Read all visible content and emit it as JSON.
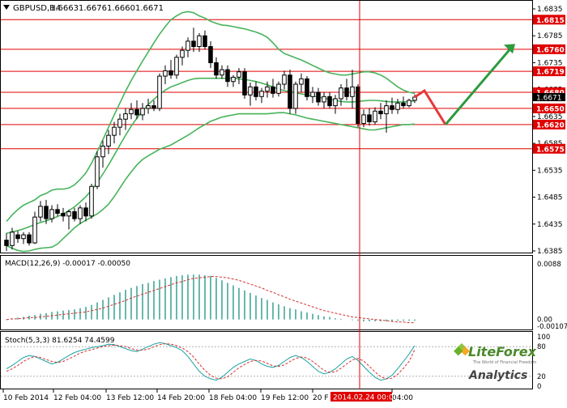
{
  "chart_data": {
    "type": "candlestick",
    "symbol_header": "GBPUSD,H4",
    "ohlc_header": [
      "1.6663",
      "1.6676",
      "1.6660",
      "1.6671"
    ],
    "x_tick_labels": [
      "10 Feb 2014",
      "12 Feb 04:00",
      "13 Feb 12:00",
      "14 Feb 20:00",
      "18 Feb 04:00",
      "19 Feb 12:00",
      "20 F",
      "04:00"
    ],
    "price_axis": {
      "ylim": [
        1.6385,
        1.6835
      ],
      "tick_labels": [
        "1.6835",
        "1.6785",
        "1.6735",
        "1.6685",
        "1.6635",
        "1.6585",
        "1.6535",
        "1.6485",
        "1.6435",
        "1.6385"
      ],
      "current_price": "1.6671"
    },
    "candles": [
      {
        "o": 1.6405,
        "h": 1.6418,
        "l": 1.6385,
        "c": 1.6395
      },
      {
        "o": 1.6395,
        "h": 1.6428,
        "l": 1.6388,
        "c": 1.642
      },
      {
        "o": 1.6415,
        "h": 1.6422,
        "l": 1.64,
        "c": 1.6408
      },
      {
        "o": 1.6408,
        "h": 1.642,
        "l": 1.6398,
        "c": 1.6415
      },
      {
        "o": 1.6415,
        "h": 1.642,
        "l": 1.6395,
        "c": 1.64
      },
      {
        "o": 1.64,
        "h": 1.6458,
        "l": 1.6398,
        "c": 1.6448
      },
      {
        "o": 1.6448,
        "h": 1.6478,
        "l": 1.644,
        "c": 1.6468
      },
      {
        "o": 1.6468,
        "h": 1.648,
        "l": 1.6435,
        "c": 1.6445
      },
      {
        "o": 1.6445,
        "h": 1.647,
        "l": 1.6438,
        "c": 1.6462
      },
      {
        "o": 1.6462,
        "h": 1.6472,
        "l": 1.645,
        "c": 1.6455
      },
      {
        "o": 1.6455,
        "h": 1.6465,
        "l": 1.644,
        "c": 1.645
      },
      {
        "o": 1.645,
        "h": 1.6462,
        "l": 1.6425,
        "c": 1.6458
      },
      {
        "o": 1.6458,
        "h": 1.6465,
        "l": 1.644,
        "c": 1.6445
      },
      {
        "o": 1.6445,
        "h": 1.647,
        "l": 1.6435,
        "c": 1.6465
      },
      {
        "o": 1.6465,
        "h": 1.6475,
        "l": 1.644,
        "c": 1.645
      },
      {
        "o": 1.645,
        "h": 1.651,
        "l": 1.6445,
        "c": 1.6505
      },
      {
        "o": 1.6505,
        "h": 1.657,
        "l": 1.65,
        "c": 1.656
      },
      {
        "o": 1.656,
        "h": 1.659,
        "l": 1.654,
        "c": 1.658
      },
      {
        "o": 1.658,
        "h": 1.661,
        "l": 1.6565,
        "c": 1.66
      },
      {
        "o": 1.66,
        "h": 1.6625,
        "l": 1.6585,
        "c": 1.6615
      },
      {
        "o": 1.6615,
        "h": 1.664,
        "l": 1.66,
        "c": 1.663
      },
      {
        "o": 1.663,
        "h": 1.665,
        "l": 1.661,
        "c": 1.664
      },
      {
        "o": 1.664,
        "h": 1.666,
        "l": 1.663,
        "c": 1.6648
      },
      {
        "o": 1.6648,
        "h": 1.6665,
        "l": 1.663,
        "c": 1.6638
      },
      {
        "o": 1.6638,
        "h": 1.666,
        "l": 1.6628,
        "c": 1.665
      },
      {
        "o": 1.665,
        "h": 1.6668,
        "l": 1.664,
        "c": 1.6655
      },
      {
        "o": 1.6655,
        "h": 1.6665,
        "l": 1.6645,
        "c": 1.665
      },
      {
        "o": 1.665,
        "h": 1.6715,
        "l": 1.6645,
        "c": 1.671
      },
      {
        "o": 1.671,
        "h": 1.673,
        "l": 1.6695,
        "c": 1.672
      },
      {
        "o": 1.672,
        "h": 1.674,
        "l": 1.6705,
        "c": 1.6712
      },
      {
        "o": 1.6712,
        "h": 1.675,
        "l": 1.6705,
        "c": 1.6745
      },
      {
        "o": 1.6745,
        "h": 1.6765,
        "l": 1.673,
        "c": 1.6758
      },
      {
        "o": 1.6758,
        "h": 1.6782,
        "l": 1.6745,
        "c": 1.6775
      },
      {
        "o": 1.6775,
        "h": 1.68,
        "l": 1.6755,
        "c": 1.6765
      },
      {
        "o": 1.6765,
        "h": 1.679,
        "l": 1.6755,
        "c": 1.6785
      },
      {
        "o": 1.6785,
        "h": 1.6795,
        "l": 1.676,
        "c": 1.6765
      },
      {
        "o": 1.6765,
        "h": 1.6775,
        "l": 1.6725,
        "c": 1.6735
      },
      {
        "o": 1.6735,
        "h": 1.6745,
        "l": 1.6705,
        "c": 1.6712
      },
      {
        "o": 1.6712,
        "h": 1.673,
        "l": 1.6705,
        "c": 1.6722
      },
      {
        "o": 1.6722,
        "h": 1.673,
        "l": 1.669,
        "c": 1.67
      },
      {
        "o": 1.67,
        "h": 1.6712,
        "l": 1.669,
        "c": 1.6708
      },
      {
        "o": 1.6708,
        "h": 1.6725,
        "l": 1.6695,
        "c": 1.6718
      },
      {
        "o": 1.6718,
        "h": 1.6725,
        "l": 1.6668,
        "c": 1.6675
      },
      {
        "o": 1.6675,
        "h": 1.6698,
        "l": 1.6655,
        "c": 1.669
      },
      {
        "o": 1.669,
        "h": 1.67,
        "l": 1.6665,
        "c": 1.6672
      },
      {
        "o": 1.6672,
        "h": 1.6688,
        "l": 1.666,
        "c": 1.6682
      },
      {
        "o": 1.6682,
        "h": 1.67,
        "l": 1.667,
        "c": 1.669
      },
      {
        "o": 1.669,
        "h": 1.6705,
        "l": 1.667,
        "c": 1.6678
      },
      {
        "o": 1.6678,
        "h": 1.67,
        "l": 1.6672,
        "c": 1.6695
      },
      {
        "o": 1.6695,
        "h": 1.672,
        "l": 1.6685,
        "c": 1.6712
      },
      {
        "o": 1.6712,
        "h": 1.6722,
        "l": 1.664,
        "c": 1.665
      },
      {
        "o": 1.665,
        "h": 1.67,
        "l": 1.664,
        "c": 1.6695
      },
      {
        "o": 1.6695,
        "h": 1.6715,
        "l": 1.668,
        "c": 1.6705
      },
      {
        "o": 1.6705,
        "h": 1.671,
        "l": 1.6665,
        "c": 1.6672
      },
      {
        "o": 1.6672,
        "h": 1.669,
        "l": 1.666,
        "c": 1.668
      },
      {
        "o": 1.668,
        "h": 1.6688,
        "l": 1.6655,
        "c": 1.6662
      },
      {
        "o": 1.6662,
        "h": 1.668,
        "l": 1.665,
        "c": 1.6672
      },
      {
        "o": 1.6672,
        "h": 1.668,
        "l": 1.665,
        "c": 1.6655
      },
      {
        "o": 1.6655,
        "h": 1.6675,
        "l": 1.664,
        "c": 1.6668
      },
      {
        "o": 1.6668,
        "h": 1.6695,
        "l": 1.6655,
        "c": 1.6688
      },
      {
        "o": 1.6688,
        "h": 1.6705,
        "l": 1.6665,
        "c": 1.6672
      },
      {
        "o": 1.6672,
        "h": 1.6722,
        "l": 1.665,
        "c": 1.669
      },
      {
        "o": 1.669,
        "h": 1.6695,
        "l": 1.6615,
        "c": 1.6622
      },
      {
        "o": 1.6622,
        "h": 1.6648,
        "l": 1.6615,
        "c": 1.6638
      },
      {
        "o": 1.6638,
        "h": 1.665,
        "l": 1.6618,
        "c": 1.6625
      },
      {
        "o": 1.6625,
        "h": 1.6652,
        "l": 1.662,
        "c": 1.6645
      },
      {
        "o": 1.6645,
        "h": 1.666,
        "l": 1.663,
        "c": 1.664
      },
      {
        "o": 1.664,
        "h": 1.6665,
        "l": 1.6605,
        "c": 1.6655
      },
      {
        "o": 1.6655,
        "h": 1.667,
        "l": 1.664,
        "c": 1.6648
      },
      {
        "o": 1.6648,
        "h": 1.6668,
        "l": 1.664,
        "c": 1.666
      },
      {
        "o": 1.666,
        "h": 1.6672,
        "l": 1.665,
        "c": 1.6655
      },
      {
        "o": 1.6655,
        "h": 1.6668,
        "l": 1.6652,
        "c": 1.6665
      },
      {
        "o": 1.6665,
        "h": 1.6676,
        "l": 1.666,
        "c": 1.6671
      }
    ],
    "bollinger_upper": [
      1.644,
      1.6452,
      1.6462,
      1.647,
      1.6475,
      1.648,
      1.6488,
      1.6492,
      1.6498,
      1.65,
      1.65,
      1.6502,
      1.6508,
      1.6518,
      1.653,
      1.6548,
      1.657,
      1.6592,
      1.6615,
      1.6638,
      1.666,
      1.6682,
      1.6702,
      1.672,
      1.6738,
      1.6755,
      1.6772,
      1.6788,
      1.6802,
      1.6815,
      1.6822,
      1.6828,
      1.683,
      1.6828,
      1.6822,
      1.6818,
      1.6812,
      1.6808,
      1.6805,
      1.6804,
      1.6802,
      1.68,
      1.6798,
      1.6795,
      1.6792,
      1.6788,
      1.6782,
      1.6772,
      1.676,
      1.6752,
      1.6748,
      1.6744,
      1.674,
      1.6735,
      1.673,
      1.6725,
      1.672,
      1.6716,
      1.6714,
      1.6712,
      1.6712,
      1.6714,
      1.6716,
      1.6718,
      1.6718,
      1.6716,
      1.6712,
      1.6706,
      1.6698,
      1.669,
      1.6684,
      1.668,
      1.6678
    ],
    "bollinger_mid": [
      1.6418,
      1.642,
      1.6423,
      1.6426,
      1.643,
      1.6434,
      1.6438,
      1.6441,
      1.6445,
      1.6449,
      1.6454,
      1.646,
      1.6467,
      1.6476,
      1.6486,
      1.6498,
      1.6512,
      1.6528,
      1.6545,
      1.6563,
      1.6582,
      1.66,
      1.6617,
      1.6632,
      1.6645,
      1.6657,
      1.6667,
      1.6676,
      1.6684,
      1.669,
      1.6694,
      1.6698,
      1.6702,
      1.6705,
      1.6706,
      1.6706,
      1.6706,
      1.6706,
      1.6706,
      1.6706,
      1.6706,
      1.6705,
      1.6704,
      1.6702,
      1.67,
      1.6697,
      1.6694,
      1.669,
      1.6686,
      1.6683,
      1.6681,
      1.6679,
      1.6677,
      1.6675,
      1.6673,
      1.6671,
      1.6669,
      1.6667,
      1.6665,
      1.6663,
      1.6662,
      1.6662,
      1.6663,
      1.6664,
      1.6665,
      1.6665,
      1.6664,
      1.6663,
      1.6662,
      1.6662,
      1.6662,
      1.6663,
      1.6664
    ],
    "bollinger_lower": [
      1.6395,
      1.639,
      1.6386,
      1.6384,
      1.6385,
      1.6388,
      1.639,
      1.6391,
      1.6392,
      1.6398,
      1.6408,
      1.6418,
      1.6428,
      1.6436,
      1.6442,
      1.6448,
      1.6454,
      1.6462,
      1.6472,
      1.6486,
      1.6502,
      1.6518,
      1.6532,
      1.6545,
      1.6555,
      1.6562,
      1.6568,
      1.6574,
      1.6578,
      1.6582,
      1.6588,
      1.6594,
      1.66,
      1.6607,
      1.6614,
      1.662,
      1.6626,
      1.663,
      1.6634,
      1.6636,
      1.6638,
      1.664,
      1.664,
      1.664,
      1.664,
      1.664,
      1.664,
      1.6641,
      1.6642,
      1.6642,
      1.664,
      1.6638,
      1.6635,
      1.6632,
      1.663,
      1.6628,
      1.6626,
      1.6624,
      1.6622,
      1.662,
      1.6618,
      1.6616,
      1.6614,
      1.6612,
      1.661,
      1.661,
      1.6612,
      1.6614,
      1.6616,
      1.6618,
      1.662,
      1.662,
      1.6621
    ],
    "horizontal_levels": [
      {
        "value": 1.6815,
        "label": "1.6815"
      },
      {
        "value": 1.676,
        "label": "1.6760"
      },
      {
        "value": 1.6719,
        "label": "1.6719"
      },
      {
        "value": 1.668,
        "label": "1.6680"
      },
      {
        "value": 1.665,
        "label": "1.6650"
      },
      {
        "value": 1.662,
        "label": "1.6620"
      },
      {
        "value": 1.6575,
        "label": "1.6575"
      }
    ],
    "vertical_marker_label": "2014.02.24 00:00",
    "forecast": {
      "red": [
        [
          1.6671,
          0
        ],
        [
          1.6683,
          0
        ],
        [
          1.662,
          0
        ]
      ],
      "green": [
        [
          1.662,
          0
        ],
        [
          1.677,
          0
        ]
      ]
    },
    "macd": {
      "header": "MACD(12,26,9) -0.00017 -0.00050",
      "tick_labels": [
        "0.0088",
        "0.00",
        "-0.00107"
      ],
      "ylim": [
        -0.00107,
        0.0088
      ],
      "histogram": [
        -0.0001,
        0.0001,
        0.0003,
        0.0004,
        0.0006,
        0.0007,
        0.0009,
        0.001,
        0.0012,
        0.0013,
        0.0014,
        0.0015,
        0.0016,
        0.0018,
        0.002,
        0.0023,
        0.0027,
        0.0031,
        0.0035,
        0.0039,
        0.0043,
        0.0047,
        0.005,
        0.0053,
        0.0056,
        0.0058,
        0.0061,
        0.0063,
        0.0065,
        0.0067,
        0.0069,
        0.007,
        0.0071,
        0.0071,
        0.0071,
        0.007,
        0.0069,
        0.0066,
        0.0062,
        0.0058,
        0.0054,
        0.005,
        0.0046,
        0.0042,
        0.0038,
        0.0034,
        0.0031,
        0.0027,
        0.0024,
        0.0021,
        0.0018,
        0.0016,
        0.0013,
        0.0011,
        0.0009,
        0.0007,
        0.0005,
        0.0004,
        0.0002,
        0.0001,
        0.0,
        -0.0001,
        -0.0002,
        -0.0003,
        -0.0003,
        -0.0003,
        -0.0003,
        -0.0003,
        -0.0003,
        -0.0002,
        -0.0002,
        -0.0002,
        -0.0002
      ],
      "signal": [
        0.0,
        0.0001,
        0.0001,
        0.0002,
        0.0003,
        0.0003,
        0.0004,
        0.0005,
        0.0006,
        0.0007,
        0.0008,
        0.0009,
        0.001,
        0.0011,
        0.0012,
        0.0014,
        0.0016,
        0.0018,
        0.0021,
        0.0024,
        0.0027,
        0.003,
        0.0034,
        0.0037,
        0.004,
        0.0043,
        0.0046,
        0.0049,
        0.0052,
        0.0055,
        0.0058,
        0.006,
        0.0063,
        0.0065,
        0.0066,
        0.0067,
        0.0068,
        0.0068,
        0.0067,
        0.0066,
        0.0064,
        0.0062,
        0.0059,
        0.0056,
        0.0053,
        0.005,
        0.0046,
        0.0043,
        0.0039,
        0.0036,
        0.0032,
        0.0029,
        0.0026,
        0.0023,
        0.002,
        0.0017,
        0.0014,
        0.0012,
        0.001,
        0.0008,
        0.0006,
        0.0004,
        0.0003,
        0.0002,
        0.0001,
        0.0,
        -0.0001,
        -0.0002,
        -0.0003,
        -0.0004,
        -0.0004,
        -0.0005,
        -0.0005
      ]
    },
    "stochastic": {
      "header": "Stoch(5,3,3) 81.6254 74.4599",
      "tick_labels": [
        "100",
        "80",
        "20",
        "0"
      ],
      "ylim": [
        0,
        100
      ],
      "main": [
        35,
        42,
        50,
        58,
        62,
        60,
        55,
        50,
        45,
        48,
        55,
        62,
        68,
        72,
        75,
        78,
        80,
        82,
        85,
        84,
        80,
        76,
        72,
        70,
        75,
        80,
        85,
        88,
        86,
        82,
        78,
        72,
        60,
        45,
        30,
        20,
        15,
        12,
        18,
        28,
        38,
        45,
        50,
        55,
        52,
        45,
        40,
        38,
        42,
        50,
        58,
        62,
        58,
        50,
        40,
        30,
        25,
        28,
        35,
        45,
        55,
        60,
        52,
        40,
        28,
        18,
        12,
        15,
        22,
        35,
        50,
        65,
        82
      ],
      "signal": [
        30,
        35,
        42,
        50,
        56,
        60,
        58,
        54,
        50,
        48,
        50,
        55,
        61,
        67,
        71,
        74,
        77,
        80,
        82,
        83,
        82,
        80,
        76,
        73,
        73,
        75,
        80,
        84,
        86,
        85,
        82,
        77,
        70,
        59,
        45,
        32,
        22,
        16,
        15,
        19,
        28,
        37,
        44,
        50,
        52,
        51,
        46,
        41,
        40,
        43,
        50,
        56,
        59,
        57,
        50,
        41,
        32,
        28,
        29,
        36,
        45,
        53,
        56,
        51,
        40,
        29,
        19,
        15,
        16,
        24,
        36,
        50,
        74
      ]
    },
    "watermark": {
      "brand": "LiteForex",
      "tagline": "The World of Financial Freedom",
      "subtitle": "Analytics"
    },
    "colors": {
      "bollinger": "#47b35a",
      "level_line": "#e00000",
      "forecast_red": "#e53935",
      "forecast_green": "#2e9a3e",
      "macd_hist": "#2a9a8a",
      "macd_signal": "#d32f2f",
      "stoch_main": "#1aa3a3",
      "stoch_signal": "#d32f2f",
      "current_price_bg": "#000000",
      "level_label_bg": "#e00000"
    }
  }
}
